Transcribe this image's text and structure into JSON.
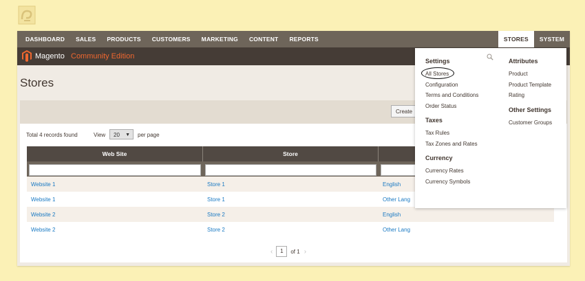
{
  "top_nav": {
    "items": [
      "DASHBOARD",
      "SALES",
      "PRODUCTS",
      "CUSTOMERS",
      "MARKETING",
      "CONTENT",
      "REPORTS"
    ],
    "active": "STORES",
    "system": "SYSTEM"
  },
  "brand": {
    "name": "Magento",
    "edition": "Community Edition"
  },
  "page": {
    "title": "Stores"
  },
  "toolbar": {
    "create_label": "Create"
  },
  "grid_info": {
    "records": "Total 4 records found",
    "view_label": "View",
    "per_page_value": "20",
    "per_page_label": "per page"
  },
  "grid": {
    "columns": [
      "Web Site",
      "Store",
      ""
    ],
    "rows": [
      [
        "Website 1",
        "Store 1",
        "English"
      ],
      [
        "Website 1",
        "Store 1",
        "Other Lang"
      ],
      [
        "Website 2",
        "Store 2",
        "English"
      ],
      [
        "Website 2",
        "Store 2",
        "Other Lang"
      ]
    ]
  },
  "pager": {
    "current": "1",
    "of": "of 1"
  },
  "stores_menu": {
    "settings": {
      "heading": "Settings",
      "items": [
        "All Stores",
        "Configuration",
        "Terms and Conditions",
        "Order Status"
      ]
    },
    "taxes": {
      "heading": "Taxes",
      "items": [
        "Tax Rules",
        "Tax Zones and Rates"
      ]
    },
    "currency": {
      "heading": "Currency",
      "items": [
        "Currency Rates",
        "Currency Symbols"
      ]
    },
    "attributes": {
      "heading": "Attributes",
      "items": [
        "Product",
        "Product Template",
        "Rating"
      ]
    },
    "other_settings": {
      "heading": "Other Settings",
      "items": [
        "Customer Groups"
      ]
    }
  },
  "colors": {
    "page_bg": "#fbf1b6",
    "nav_bg": "#6e655a",
    "brand_bg": "#453c36",
    "accent": "#ef672f",
    "link": "#1979c3"
  }
}
